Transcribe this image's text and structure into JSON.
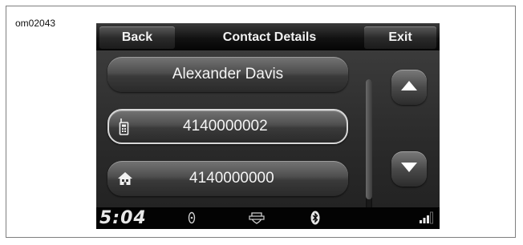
{
  "figure_id": "om02043",
  "header": {
    "back_label": "Back",
    "title": "Contact Details",
    "exit_label": "Exit"
  },
  "contact": {
    "name": "Alexander Davis",
    "numbers": [
      {
        "type": "mobile",
        "icon": "mobile-phone-icon",
        "value": "4140000002",
        "selected": true
      },
      {
        "type": "home",
        "icon": "home-icon",
        "value": "4140000000",
        "selected": false
      }
    ]
  },
  "scroll": {
    "up_icon": "triangle-up-icon",
    "down_icon": "triangle-down-icon"
  },
  "status": {
    "time": "5:04",
    "icons": [
      "media-icon",
      "bar-and-shield-logo-icon",
      "bluetooth-icon",
      "signal-strength-icon"
    ]
  },
  "colors": {
    "screen_bg": "#070707",
    "button_text": "#f2f2f2"
  }
}
